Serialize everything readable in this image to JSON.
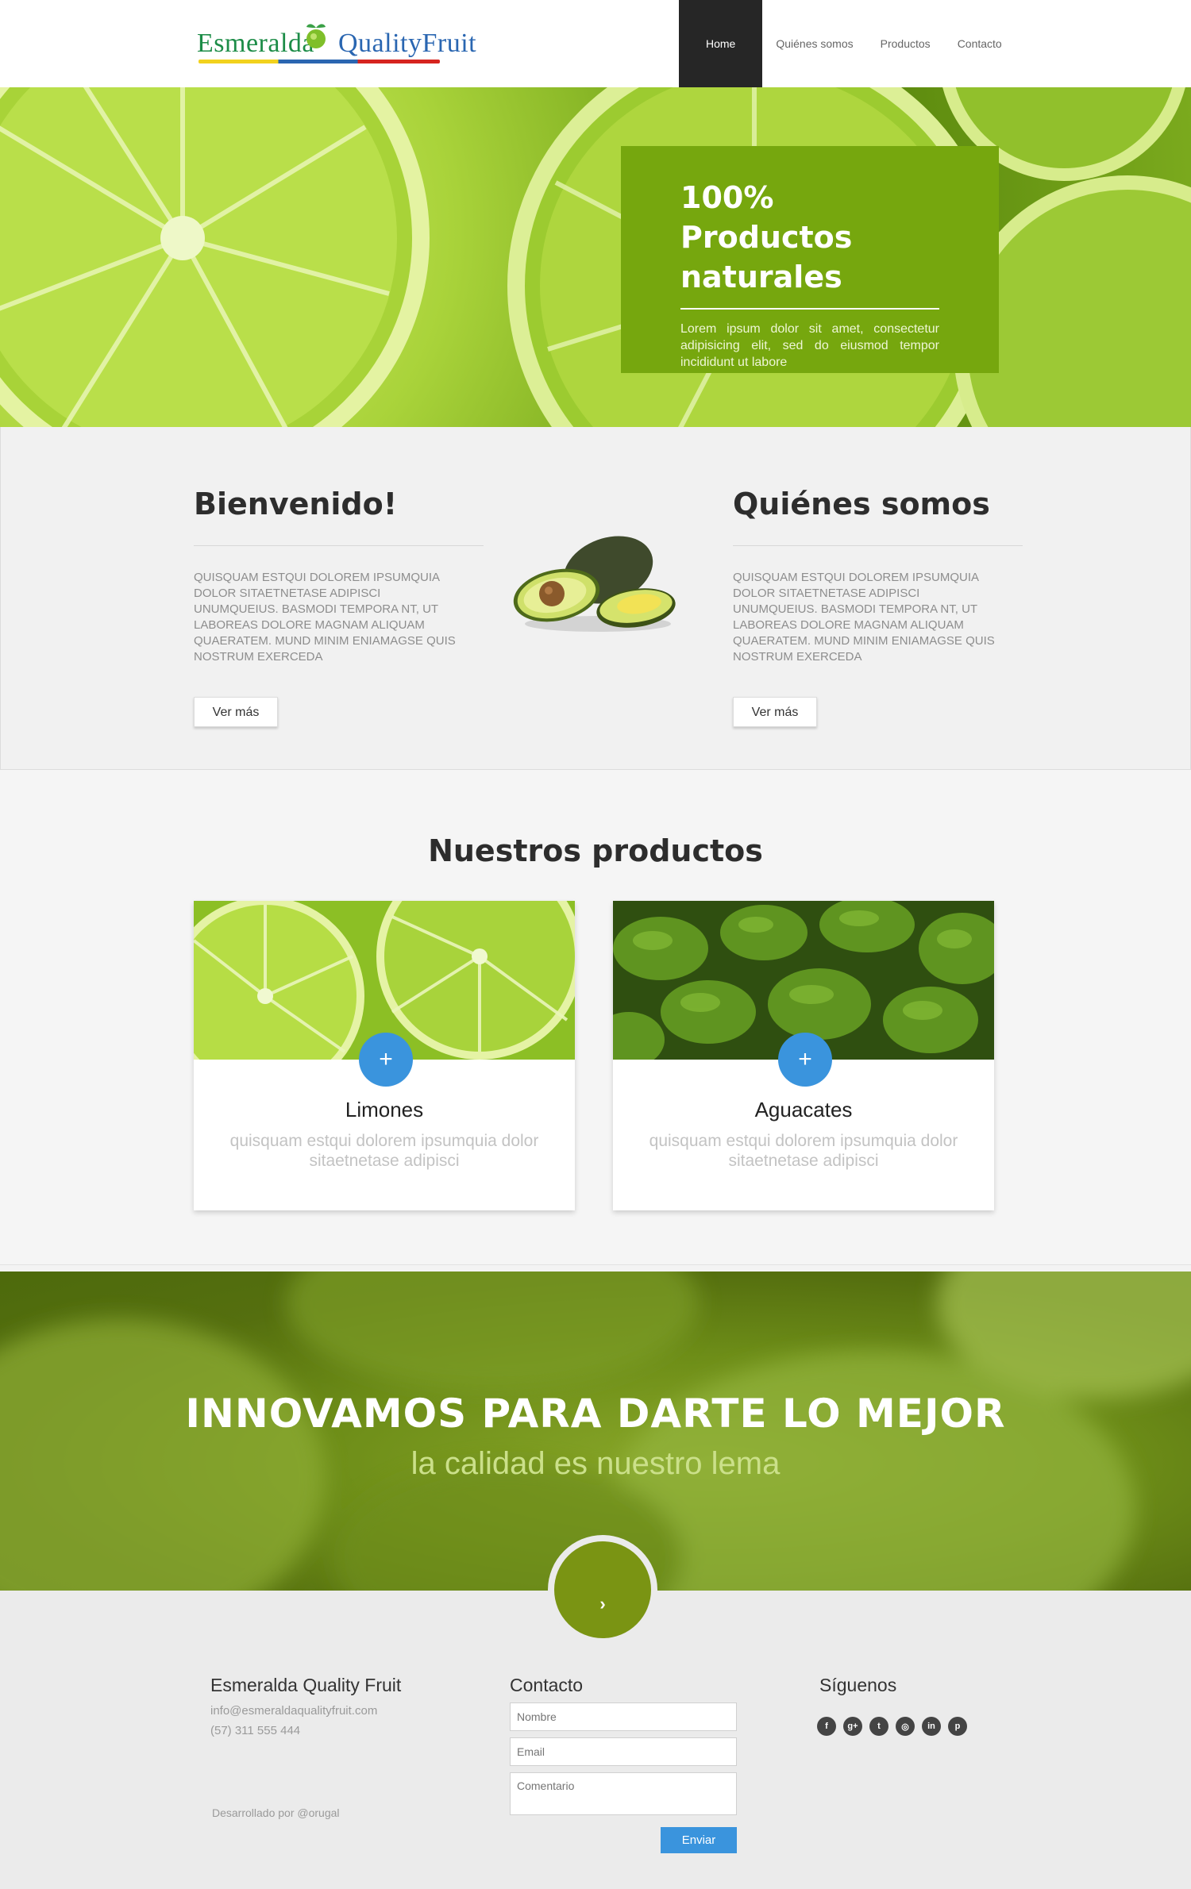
{
  "header": {
    "logo": {
      "part1": "Esmeralda",
      "part2": "Quality",
      "part3": "Fruit"
    },
    "nav": [
      {
        "label": "Home",
        "active": true
      },
      {
        "label": "Quiénes somos",
        "active": false
      },
      {
        "label": "Productos",
        "active": false
      },
      {
        "label": "Contacto",
        "active": false
      }
    ]
  },
  "hero": {
    "title_line1": "100% Productos",
    "title_line2": "naturales",
    "text": "Lorem ipsum dolor sit amet, consectetur adipisicing elit, sed do eiusmod tempor incididunt ut labore"
  },
  "welcome": {
    "left": {
      "title": "Bienvenido!",
      "text": "Quisquam estqui dolorem ipsumquia dolor sitaetnetase adipisci unumqueius. Basmodi tempora nt, ut laboreas dolore magnam aliquam quaeratem. Mund minim eniamagse quis nostrum exerceda",
      "button": "Ver más"
    },
    "right": {
      "title": "Quiénes somos",
      "text": "Quisquam estqui dolorem ipsumquia dolor sitaetnetase adipisci unumqueius. Basmodi tempora nt, ut laboreas dolore magnam aliquam quaeratem. Mund minim eniamagse quis nostrum exerceda",
      "button": "Ver más"
    }
  },
  "products": {
    "title": "Nuestros productos",
    "items": [
      {
        "name": "Limones",
        "description": "quisquam estqui dolorem ipsumquia dolor sitaetnetase adipisci",
        "button": "+"
      },
      {
        "name": "Aguacates",
        "description": "quisquam estqui dolorem ipsumquia dolor sitaetnetase adipisci",
        "button": "+"
      }
    ]
  },
  "banner": {
    "title": "INNOVAMOS PARA DARTE LO MEJOR",
    "subtitle": "la calidad es nuestro lema",
    "button_icon": "›"
  },
  "footer": {
    "company": {
      "title": "Esmeralda Quality Fruit",
      "email": "info@esmeraldaqualityfruit.com",
      "phone": "(57) 311 555 444"
    },
    "credit": "Desarrollado por @orugal",
    "contact": {
      "title": "Contacto",
      "name_placeholder": "Nombre",
      "email_placeholder": "Email",
      "comment_placeholder": "Comentario",
      "submit": "Enviar"
    },
    "social": {
      "title": "Síguenos",
      "icons": [
        {
          "name": "facebook-icon",
          "glyph": "f"
        },
        {
          "name": "google-plus-icon",
          "glyph": "g+"
        },
        {
          "name": "twitter-icon",
          "glyph": "t"
        },
        {
          "name": "dribbble-icon",
          "glyph": "◎"
        },
        {
          "name": "linkedin-icon",
          "glyph": "in"
        },
        {
          "name": "pinterest-icon",
          "glyph": "p"
        }
      ]
    }
  },
  "colors": {
    "accent_green": "#76a70e",
    "accent_blue": "#3a94dd",
    "nav_active": "#262626"
  }
}
